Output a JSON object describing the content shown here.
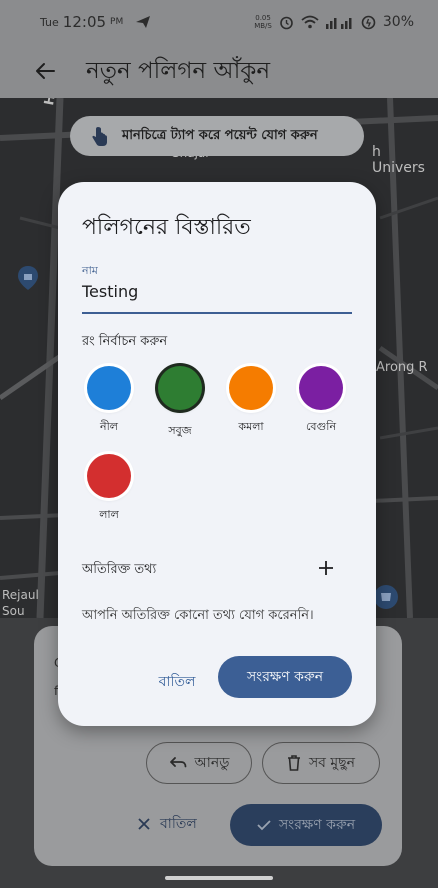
{
  "status_bar": {
    "day": "Tue",
    "time": "12:05",
    "ampm": "PM",
    "speed_value": "0.05",
    "speed_unit": "MB/S",
    "battery": "30%"
  },
  "app_bar": {
    "title": "নতুন পলিগন আঁকুন"
  },
  "map": {
    "hint": "মানচিত্রে ট্যাপ করে পয়েন্ট যোগ করুন",
    "labels": [
      "Himultalroad",
      "Shajal",
      "h Univers",
      "Arong R",
      "Rejaul",
      "Sou"
    ]
  },
  "dialog": {
    "title": "পলিগনের বিস্তারিত",
    "name_label": "নাম",
    "name_value": "Testing",
    "color_heading": "রং নির্বাচন করুন",
    "colors": [
      {
        "label": "নীল",
        "hex": "#1e7fd8",
        "selected": false
      },
      {
        "label": "সবুজ",
        "hex": "#2e7d32",
        "selected": true
      },
      {
        "label": "কমলা",
        "hex": "#f57c00",
        "selected": false
      },
      {
        "label": "বেগুনি",
        "hex": "#7b1fa2",
        "selected": false
      },
      {
        "label": "লাল",
        "hex": "#d32f2f",
        "selected": false
      }
    ],
    "extra_heading": "অতিরিক্ত তথ্য",
    "extra_empty": "আপনি অতিরিক্ত কোনো তথ্য যোগ করেননি।",
    "cancel_label": "বাতিল",
    "save_label": "সংরক্ষণ করুন"
  },
  "sheet": {
    "peek_line1": "C",
    "peek_line2": "f",
    "undo_label": "আনডু",
    "clear_label": "সব মুছুন",
    "cancel_label": "বাতিল",
    "save_label": "সংরক্ষণ করুন"
  }
}
